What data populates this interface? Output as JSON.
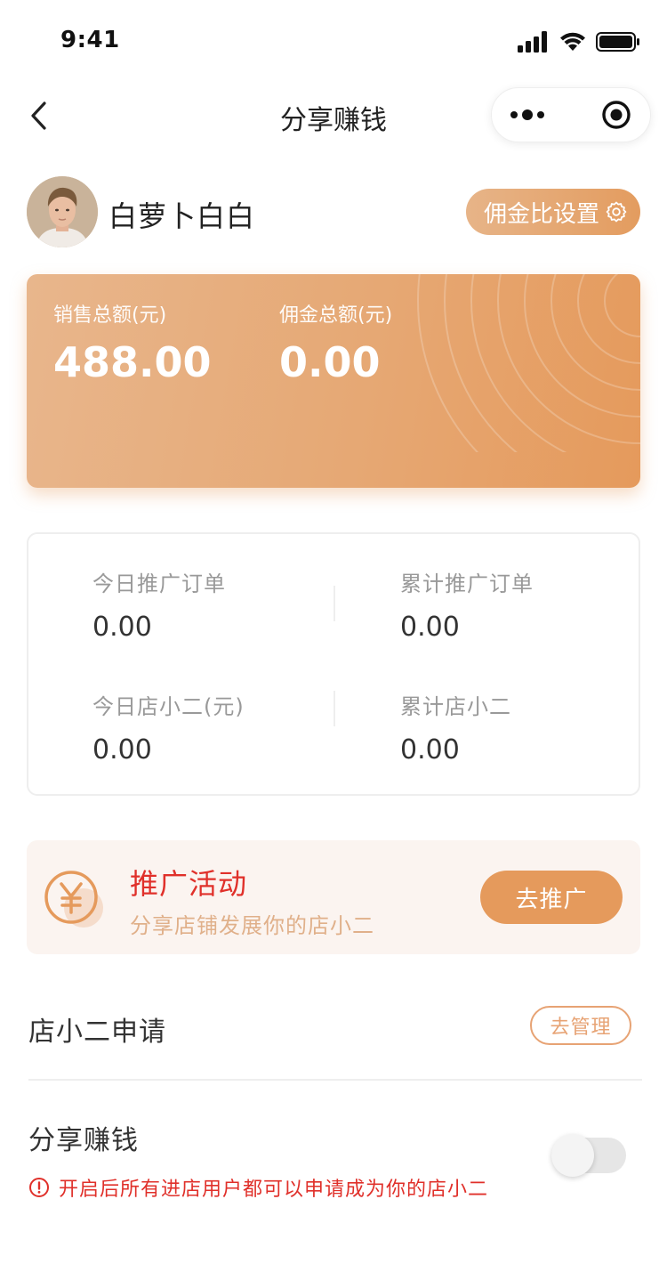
{
  "status_bar": {
    "time": "9:41"
  },
  "nav": {
    "title": "分享赚钱"
  },
  "profile": {
    "name": "白萝卜白白",
    "commission_button": "佣金比设置"
  },
  "sales_card": {
    "sales_label": "销售总额(元)",
    "sales_value": "488.00",
    "commission_label": "佣金总额(元)",
    "commission_value": "0.00"
  },
  "stats": [
    {
      "label": "今日推广订单",
      "value": "0.00"
    },
    {
      "label": "累计推广订单",
      "value": "0.00"
    },
    {
      "label": "今日店小二(元)",
      "value": "0.00"
    },
    {
      "label": "累计店小二",
      "value": "0.00"
    }
  ],
  "promo": {
    "icon": "yen-icon",
    "title": "推广活动",
    "subtitle": "分享店铺发展你的店小二",
    "button": "去推广"
  },
  "apply": {
    "title": "店小二申请",
    "button": "去管理"
  },
  "share": {
    "title": "分享赚钱",
    "warning": "开启后所有进店用户都可以申请成为你的店小二",
    "enabled": false
  },
  "colors": {
    "accent": "#e59a5c",
    "warning_red": "#e0302a",
    "promo_bg": "#fbf4f0"
  }
}
